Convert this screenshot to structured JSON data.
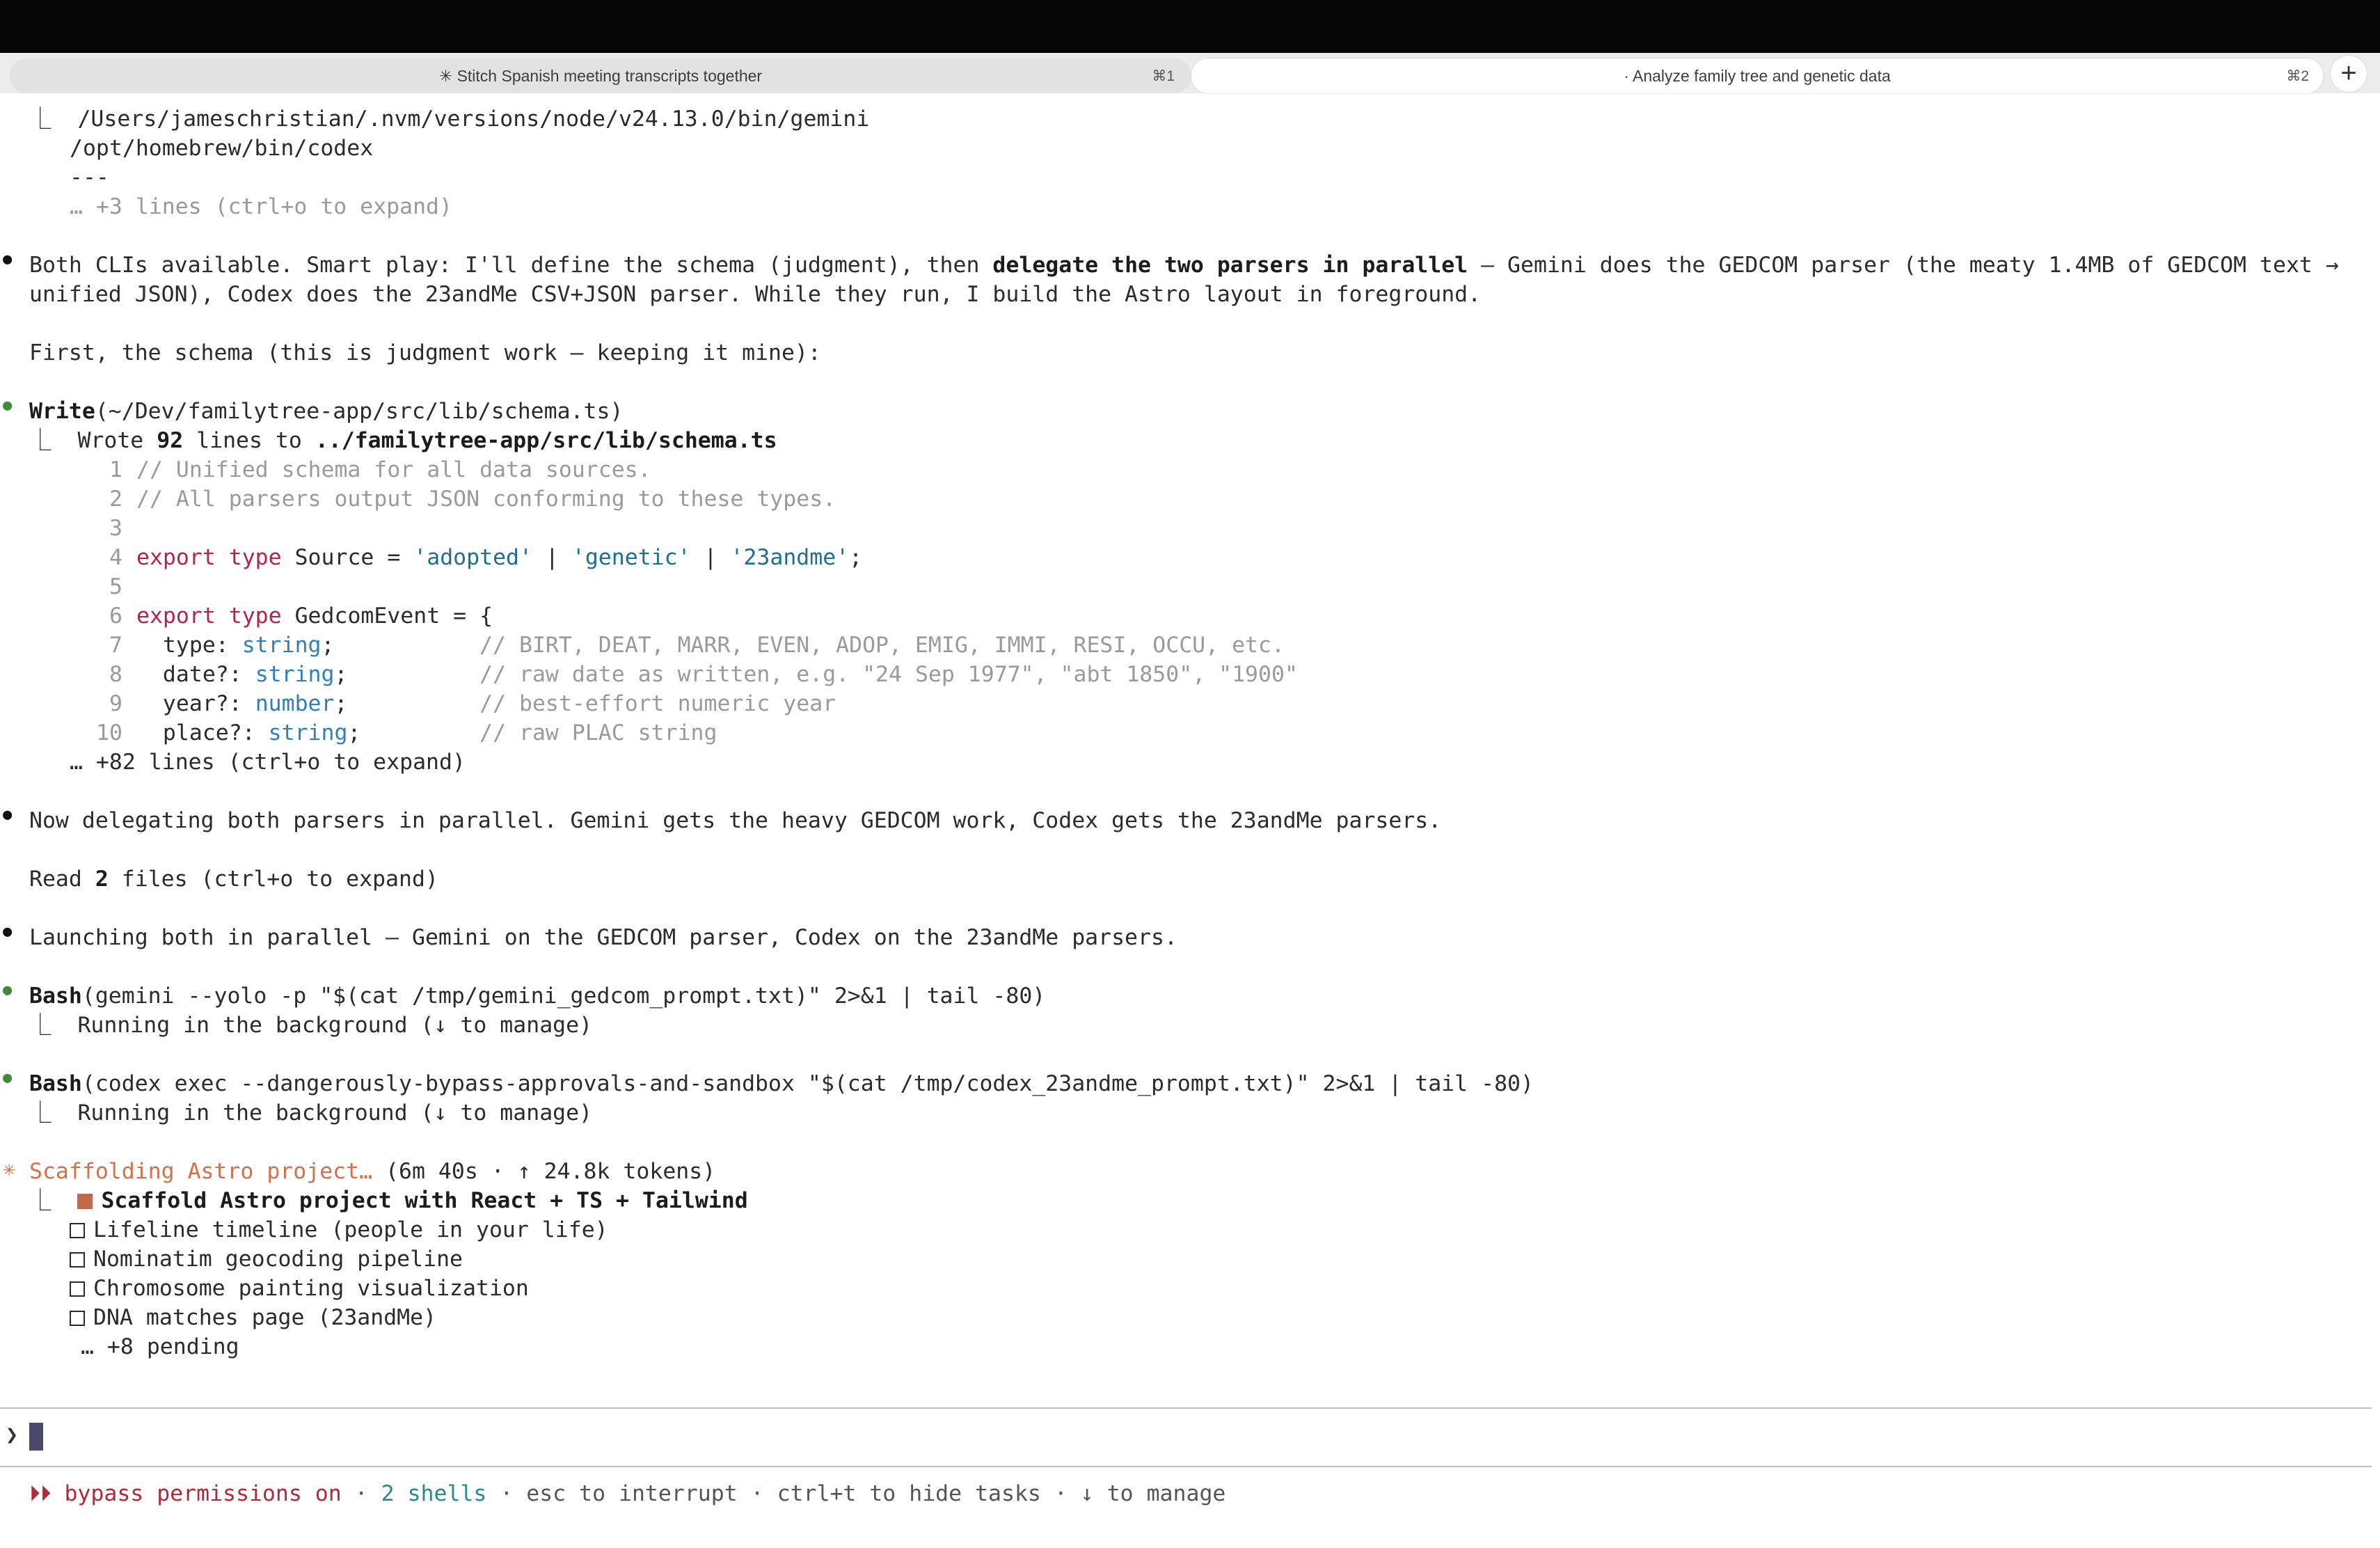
{
  "tabs": [
    {
      "label": "✳ Stitch Spanish meeting transcripts together",
      "shortcut": "⌘1"
    },
    {
      "label": "· Analyze family tree and genetic data",
      "shortcut": "⌘2"
    }
  ],
  "new_tab_label": "+",
  "which": {
    "line1": "/Users/jameschristian/.nvm/versions/node/v24.13.0/bin/gemini",
    "line2": "/opt/homebrew/bin/codex",
    "line3": "---",
    "more": "… +3 lines (ctrl+o to expand)"
  },
  "msg1": {
    "pre": "Both CLIs available. Smart play: I'll define the schema (judgment), then ",
    "bold": "delegate the two parsers in parallel",
    "post": " — Gemini does the GEDCOM parser (the meaty 1.4MB of GEDCOM text →",
    "line2": "unified JSON), Codex does the 23andMe CSV+JSON parser. While they run, I build the Astro layout in foreground."
  },
  "msg2": "First, the schema (this is judgment work — keeping it mine):",
  "write_tool": {
    "name": "Write",
    "arg": "(~/Dev/familytree-app/src/lib/schema.ts)",
    "result_pre": "Wrote ",
    "result_count": "92",
    "result_mid": " lines to ",
    "result_path": "../familytree-app/src/lib/schema.ts",
    "more": "… +82 lines (ctrl+o to expand)"
  },
  "code": {
    "n1": "1",
    "l1": "// Unified schema for all data sources.",
    "n2": "2",
    "l2": "// All parsers output JSON conforming to these types.",
    "n3": "3",
    "n4": "4",
    "l4_kw": "export type",
    "l4_name": " Source = ",
    "l4_s1": "'adopted'",
    "l4_p1": " | ",
    "l4_s2": "'genetic'",
    "l4_p2": " | ",
    "l4_s3": "'23andme'",
    "l4_end": ";",
    "n5": "5",
    "n6": "6",
    "l6_kw": "export type",
    "l6_rest": " GedcomEvent = {",
    "n7": "7",
    "l7_f": "  type: ",
    "l7_t": "string",
    "l7_pad": ";           ",
    "l7_c": "// BIRT, DEAT, MARR, EVEN, ADOP, EMIG, IMMI, RESI, OCCU, etc.",
    "n8": "8",
    "l8_f": "  date?: ",
    "l8_t": "string",
    "l8_pad": ";          ",
    "l8_c": "// raw date as written, e.g. \"24 Sep 1977\", \"abt 1850\", \"1900\"",
    "n9": "9",
    "l9_f": "  year?: ",
    "l9_t": "number",
    "l9_pad": ";          ",
    "l9_c": "// best-effort numeric year",
    "n10": "10",
    "l10_f": "  place?: ",
    "l10_t": "string",
    "l10_pad": ";         ",
    "l10_c": "// raw PLAC string"
  },
  "msg3": "Now delegating both parsers in parallel. Gemini gets the heavy GEDCOM work, Codex gets the 23andMe parsers.",
  "read": {
    "pre": "Read ",
    "count": "2",
    "post": " files (ctrl+o to expand)"
  },
  "msg4": "Launching both in parallel — Gemini on the GEDCOM parser, Codex on the 23andMe parsers.",
  "bash1": {
    "name": "Bash",
    "arg": "(gemini --yolo -p \"$(cat /tmp/gemini_gedcom_prompt.txt)\" 2>&1 | tail -80)",
    "result": "Running in the background (↓ to manage)"
  },
  "bash2": {
    "name": "Bash",
    "arg": "(codex exec --dangerously-bypass-approvals-and-sandbox \"$(cat /tmp/codex_23andme_prompt.txt)\" 2>&1 | tail -80)",
    "result": "Running in the background (↓ to manage)"
  },
  "task": {
    "title": "Scaffolding Astro project…",
    "meta": " (6m 40s · ↑ 24.8k tokens)",
    "items": [
      "Scaffold Astro project with React + TS + Tailwind",
      "Lifeline timeline (people in your life)",
      "Nominatim geocoding pipeline",
      "Chromosome painting visualization",
      "DNA matches page (23andMe)"
    ],
    "pending": "… +8 pending"
  },
  "prompt_symbol": "❯",
  "status": {
    "mode": "⏵⏵ bypass permissions on",
    "sep1": " · ",
    "shells": "2 shells",
    "rest": " · esc to interrupt · ctrl+t to hide tasks · ↓ to manage"
  },
  "colors": {
    "accent": "#d3704a",
    "green": "#3f8a3f",
    "red": "#b22a3a",
    "teal": "#2a8a8a"
  }
}
